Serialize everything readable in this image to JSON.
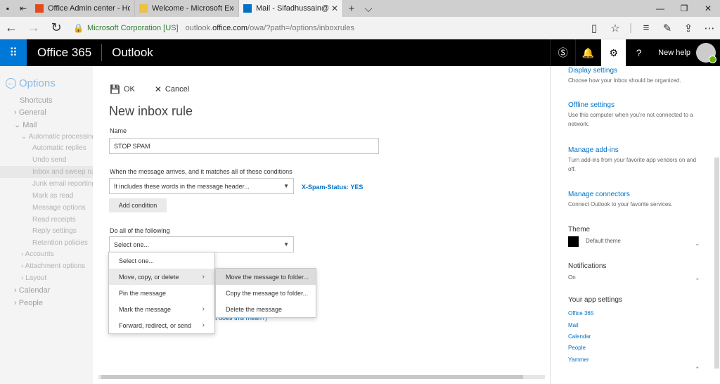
{
  "browser": {
    "tabs": [
      {
        "label": "Office Admin center - Home",
        "icon_color": "#e64a19",
        "active": false
      },
      {
        "label": "Welcome - Microsoft Exchange",
        "icon_color": "#f0c040",
        "active": false
      },
      {
        "label": "Mail - Sifadhussain@Ne",
        "icon_color": "#0072c6",
        "active": true
      }
    ],
    "new_tab_glyph": "+",
    "tab_menu_glyph": "⌵",
    "address": {
      "org": "Microsoft Corporation [US]",
      "host_pre": "outlook.",
      "host_main": "office.com",
      "path": "/owa/?path=/options/inboxrules"
    }
  },
  "header": {
    "brand": "Office 365",
    "app": "Outlook",
    "user": "New help"
  },
  "leftnav": {
    "title": "Options",
    "items": [
      {
        "label": "Shortcuts",
        "prefix": ""
      },
      {
        "label": "General",
        "prefix": "›"
      },
      {
        "label": "Mail",
        "prefix": "⌄"
      },
      {
        "label": "Automatic processing",
        "prefix": "⌄"
      },
      {
        "label": "Automatic replies",
        "prefix": ""
      },
      {
        "label": "Undo send",
        "prefix": ""
      },
      {
        "label": "Inbox and sweep rules",
        "prefix": ""
      },
      {
        "label": "Junk email reporting",
        "prefix": ""
      },
      {
        "label": "Mark as read",
        "prefix": ""
      },
      {
        "label": "Message options",
        "prefix": ""
      },
      {
        "label": "Read receipts",
        "prefix": ""
      },
      {
        "label": "Reply settings",
        "prefix": ""
      },
      {
        "label": "Retention policies",
        "prefix": ""
      },
      {
        "label": "Accounts",
        "prefix": "›"
      },
      {
        "label": "Attachment options",
        "prefix": "›"
      },
      {
        "label": "Layout",
        "prefix": "›"
      },
      {
        "label": "Calendar",
        "prefix": "›"
      },
      {
        "label": "People",
        "prefix": "›"
      }
    ]
  },
  "form": {
    "ok_label": "OK",
    "cancel_label": "Cancel",
    "title": "New inbox rule",
    "name_label": "Name",
    "name_value": "STOP SPAM",
    "condition_label": "When the message arrives, and it matches all of these conditions",
    "condition_value": "It includes these words in the message header...",
    "condition_words": "X-Spam-Status: YES",
    "add_condition_label": "Add condition",
    "action_label": "Do all of the following",
    "action_value": "Select one...",
    "hidden_link": "t does this mean?)"
  },
  "menu": {
    "items": [
      {
        "label": "Select one...",
        "has_sub": false
      },
      {
        "label": "Move, copy, or delete",
        "has_sub": true
      },
      {
        "label": "Pin the message",
        "has_sub": false
      },
      {
        "label": "Mark the message",
        "has_sub": true
      },
      {
        "label": "Forward, redirect, or send",
        "has_sub": true
      }
    ],
    "submenu": [
      {
        "label": "Move the message to folder..."
      },
      {
        "label": "Copy the message to folder..."
      },
      {
        "label": "Delete the message"
      }
    ]
  },
  "settings": {
    "sections": [
      {
        "title": "Display settings",
        "desc": "Choose how your Inbox should be organized."
      },
      {
        "title": "Offline settings",
        "desc": "Use this computer when you're not connected to a network."
      },
      {
        "title": "Manage add-ins",
        "desc": "Turn add-ins from your favorite app vendors on and off."
      },
      {
        "title": "Manage connectors",
        "desc": "Connect Outlook to your favorite services."
      }
    ],
    "theme_label": "Theme",
    "theme_value": "Default theme",
    "notifications_label": "Notifications",
    "notifications_value": "On",
    "app_settings_label": "Your app settings",
    "app_links": [
      "Office 365",
      "Mail",
      "Calendar",
      "People",
      "Yammer"
    ]
  }
}
